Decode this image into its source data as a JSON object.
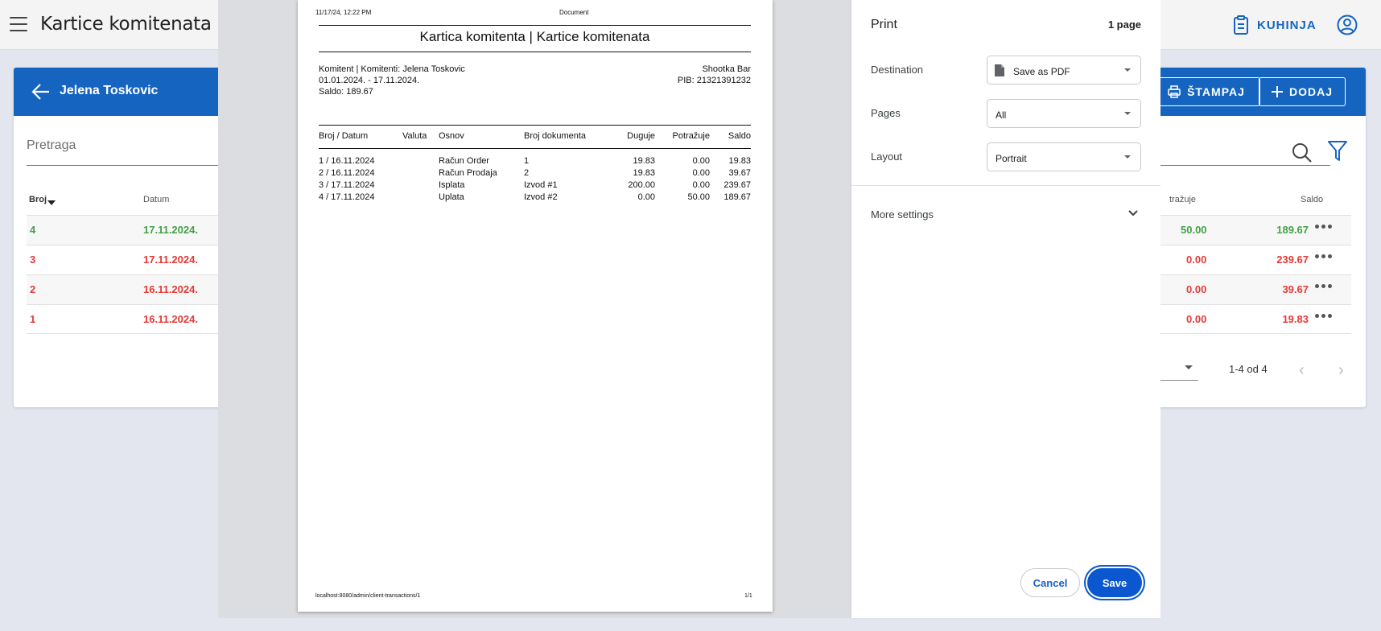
{
  "app": {
    "title": "Kartice komitenata",
    "kitchen_label": "KUHINJA"
  },
  "card": {
    "client_name": "Jelena Toskovic",
    "print_label": "ŠTAMPAJ",
    "add_label": "DODAJ",
    "search_placeholder": "Pretraga"
  },
  "table": {
    "headers": {
      "broj": "Broj",
      "datum": "Datum",
      "potrazuje": "Potražuje",
      "saldo": "Saldo"
    },
    "visible_potrazuje_header": "tražuje",
    "rows": [
      {
        "broj": "4",
        "datum": "17.11.2024.",
        "potrazuje": "50.00",
        "saldo": "189.67",
        "status": "green"
      },
      {
        "broj": "3",
        "datum": "17.11.2024.",
        "potrazuje": "0.00",
        "saldo": "239.67",
        "status": "red"
      },
      {
        "broj": "2",
        "datum": "16.11.2024.",
        "potrazuje": "0.00",
        "saldo": "39.67",
        "status": "red"
      },
      {
        "broj": "1",
        "datum": "16.11.2024.",
        "potrazuje": "0.00",
        "saldo": "19.83",
        "status": "red"
      }
    ],
    "pagination": "1-4 od 4"
  },
  "preview": {
    "header_datetime": "11/17/24, 12:22 PM",
    "header_doc": "Document",
    "title": "Kartica komitenta | Kartice komitenata",
    "meta_left": [
      "Komitent | Komitenti: Jelena Toskovic",
      "01.01.2024. - 17.11.2024.",
      "Saldo: 189.67"
    ],
    "meta_right": [
      "Shootka Bar",
      "PIB: 21321391232"
    ],
    "columns": [
      "Broj / Datum",
      "Valuta",
      "Osnov",
      "Broj dokumenta",
      "Duguje",
      "Potražuje",
      "Saldo"
    ],
    "rows": [
      [
        "1 / 16.11.2024",
        "",
        "Račun Order",
        "1",
        "19.83",
        "0.00",
        "19.83"
      ],
      [
        "2 / 16.11.2024",
        "",
        "Račun Prodaja",
        "2",
        "19.83",
        "0.00",
        "39.67"
      ],
      [
        "3 / 17.11.2024",
        "",
        "Isplata",
        "Izvod #1",
        "200.00",
        "0.00",
        "239.67"
      ],
      [
        "4 / 17.11.2024",
        "",
        "Uplata",
        "Izvod #2",
        "0.00",
        "50.00",
        "189.67"
      ]
    ],
    "footer_url": "localhost:8080/admin/client-transactions/1",
    "footer_page": "1/1"
  },
  "print_panel": {
    "title": "Print",
    "page_count": "1 page",
    "destination_label": "Destination",
    "destination_value": "Save as PDF",
    "pages_label": "Pages",
    "pages_value": "All",
    "layout_label": "Layout",
    "layout_value": "Portrait",
    "more_settings": "More settings",
    "cancel": "Cancel",
    "save": "Save"
  },
  "colors": {
    "brand": "#1565c0",
    "positive": "#43a047",
    "negative": "#e53935",
    "save_button": "#0b57d0"
  }
}
